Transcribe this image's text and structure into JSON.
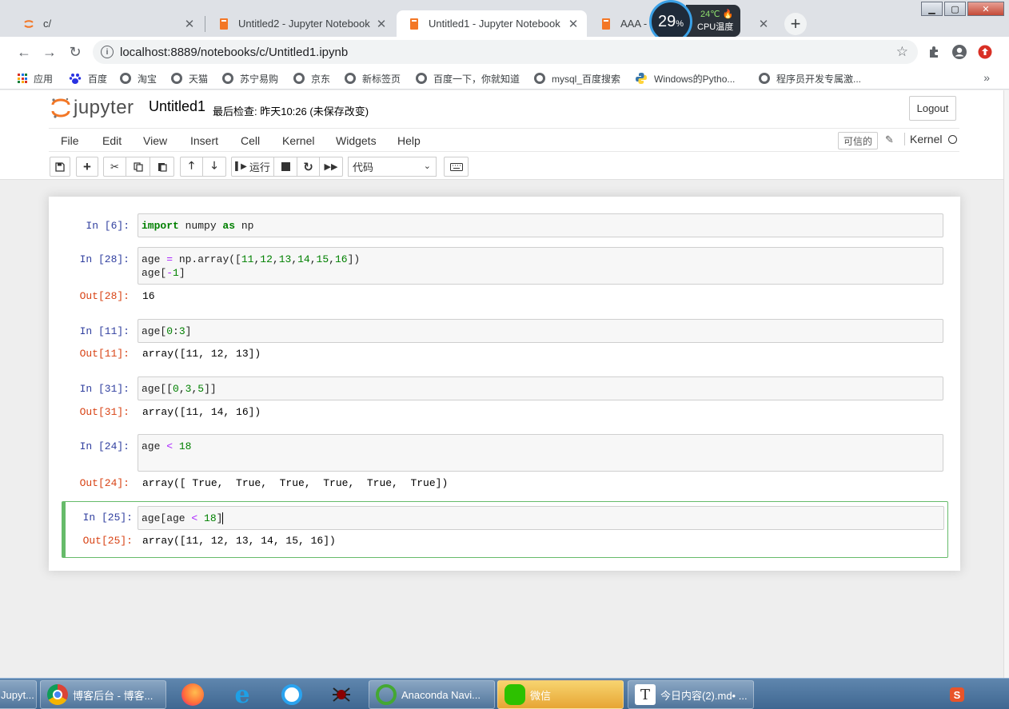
{
  "browser": {
    "tabs": [
      {
        "title": "c/",
        "active": false
      },
      {
        "title": "Untitled2 - Jupyter Notebook",
        "active": false
      },
      {
        "title": "Untitled1 - Jupyter Notebook",
        "active": true
      },
      {
        "title": "AAA - J",
        "active": false
      }
    ],
    "url": "localhost:8889/notebooks/c/Untitled1.ipynb",
    "bookmarks": [
      "应用",
      "百度",
      "淘宝",
      "天猫",
      "苏宁易购",
      "京东",
      "新标签页",
      "百度一下，你就知道",
      "mysql_百度搜索",
      "Windows的Pytho...",
      "程序员开发专属激..."
    ]
  },
  "cpu_widget": {
    "percent": "29",
    "percent_sign": "%",
    "temp": "24℃",
    "label": "CPU温度"
  },
  "jupyter": {
    "logo_text": "jupyter",
    "notebook_name": "Untitled1",
    "checkpoint": "最后检查: 昨天10:26  (未保存改变)",
    "logout": "Logout",
    "menu": [
      "File",
      "Edit",
      "View",
      "Insert",
      "Cell",
      "Kernel",
      "Widgets",
      "Help"
    ],
    "trusted": "可信的",
    "kernel_label": "Kernel",
    "run_label": "运行",
    "cell_type": "代码"
  },
  "cells": [
    {
      "in": "In  [6]:",
      "code_line1": "import numpy as np"
    },
    {
      "in": "In  [28]:",
      "out": "Out[28]:",
      "output": "16"
    },
    {
      "in": "In  [11]:",
      "out": "Out[11]:",
      "output": "array([11, 12, 13])"
    },
    {
      "in": "In  [31]:",
      "out": "Out[31]:",
      "output": "array([11, 14, 16])"
    },
    {
      "in": "In  [24]:",
      "out": "Out[24]:",
      "output": "array([ True,  True,  True,  True,  True,  True])"
    },
    {
      "in": "In  [25]:",
      "out": "Out[25]:",
      "output": "array([11, 12, 13, 14, 15, 16])"
    }
  ],
  "taskbar": {
    "items": [
      "Jupyt...",
      "博客后台 - 博客...",
      "Anaconda Navi...",
      "微信",
      "今日内容(2).md• ..."
    ]
  },
  "colors": {
    "jupyter_orange": "#f37726",
    "selected_cell": "#66bb6a",
    "in_prompt": "#303f9f",
    "out_prompt": "#d84315"
  }
}
